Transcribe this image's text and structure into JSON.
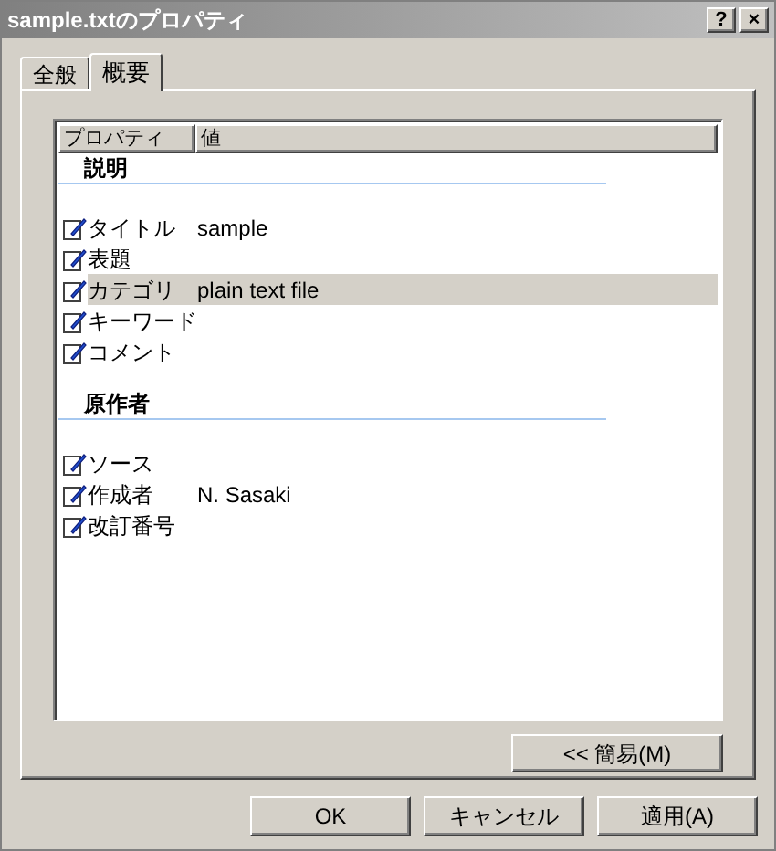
{
  "window": {
    "title": "sample.txtのプロパティ",
    "buttons": [
      "?",
      "×"
    ]
  },
  "tabs": [
    {
      "label": "全般",
      "selected": false
    },
    {
      "label": "概要",
      "selected": true
    }
  ],
  "table": {
    "columns": [
      "プロパティ",
      "値"
    ],
    "groups": [
      {
        "title": "説明",
        "rows": [
          {
            "name": "タイトル",
            "value": "sample",
            "selected": false
          },
          {
            "name": "表題",
            "selected": false
          },
          {
            "name": "カテゴリ",
            "value": "plain text file",
            "selected": true
          },
          {
            "name": "キーワード",
            "selected": false
          },
          {
            "name": "コメント",
            "selected": false
          }
        ]
      },
      {
        "title": "原作者",
        "rows": [
          {
            "name": "ソース",
            "selected": false
          },
          {
            "name": "作成者",
            "value": "N. Sasaki",
            "selected": false
          },
          {
            "name": "改訂番号",
            "selected": false
          }
        ]
      }
    ]
  },
  "simple_button": "<< 簡易(M)",
  "buttons": [
    "OK",
    "キャンセル",
    "適用(A)"
  ]
}
